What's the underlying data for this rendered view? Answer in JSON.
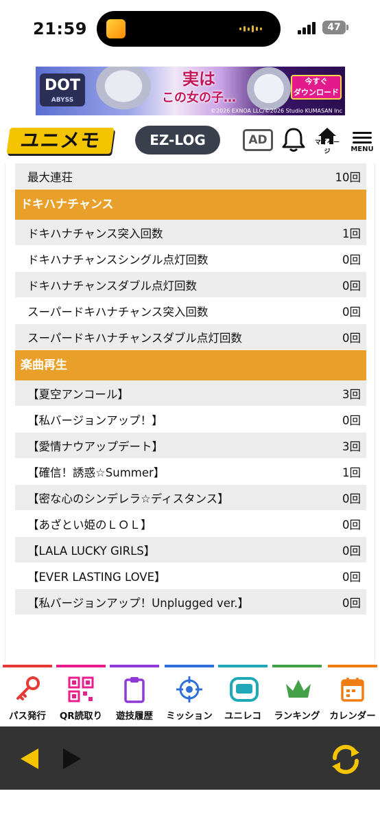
{
  "status_bar": {
    "time": "21:59",
    "battery": "47"
  },
  "banner": {
    "game_logo": "DOT",
    "game_logo_sub": "ABYSS",
    "copy_line1": "実は",
    "copy_line2": "この女の子…",
    "cta_line1": "今すぐ",
    "cta_line2": "ダウンロード",
    "copyright": "©2026 EXNOA LLC/©2026 Studio KUMASAN Inc"
  },
  "header": {
    "logo": "ユニメモ",
    "ezlog_label": "EZ-LOG",
    "ad_label": "AD",
    "mypage_label": "マイページ",
    "menu_label": "MENU"
  },
  "stats": {
    "top_rows": [
      {
        "label": "最大連荘",
        "value": "10回"
      }
    ],
    "sections": [
      {
        "title": "ドキハナチャンス",
        "rows": [
          {
            "label": "ドキハナチャンス突入回数",
            "value": "1回"
          },
          {
            "label": "ドキハナチャンスシングル点灯回数",
            "value": "0回"
          },
          {
            "label": "ドキハナチャンスダブル点灯回数",
            "value": "0回"
          },
          {
            "label": "スーパードキハナチャンス突入回数",
            "value": "0回"
          },
          {
            "label": "スーパードキハナチャンスダブル点灯回数",
            "value": "0回"
          }
        ]
      },
      {
        "title": "楽曲再生",
        "rows": [
          {
            "label": "【夏空アンコール】",
            "value": "3回"
          },
          {
            "label": "【私バージョンアップ！】",
            "value": "0回"
          },
          {
            "label": "【愛情ナウアップデート】",
            "value": "3回"
          },
          {
            "label": "【確信！誘惑☆Summer】",
            "value": "1回"
          },
          {
            "label": "【密な心のシンデレラ☆ディスタンス】",
            "value": "0回"
          },
          {
            "label": "【あざとい姫のＬＯＬ】",
            "value": "0回"
          },
          {
            "label": "【LALA LUCKY GIRLS】",
            "value": "0回"
          },
          {
            "label": "【EVER LASTING LOVE】",
            "value": "0回"
          },
          {
            "label": "【私バージョンアップ！Unplugged ver.】",
            "value": "0回"
          }
        ]
      }
    ]
  },
  "tabbar": {
    "tabs": [
      {
        "label": "パス発行",
        "icon": "key-icon",
        "color": "#e53935"
      },
      {
        "label": "QR読取り",
        "icon": "qr-code-icon",
        "color": "#e91e8c"
      },
      {
        "label": "遊技履歴",
        "icon": "clipboard-icon",
        "color": "#8e3ad6"
      },
      {
        "label": "ミッション",
        "icon": "target-icon",
        "color": "#2f6fd8"
      },
      {
        "label": "ユニレコ",
        "icon": "unireco-icon",
        "color": "#20a8b8"
      },
      {
        "label": "ランキング",
        "icon": "crown-icon",
        "color": "#43a047"
      },
      {
        "label": "カレンダー",
        "icon": "calendar-icon",
        "color": "#ef7d12"
      }
    ]
  },
  "navbar": {
    "back_icon": "back-arrow-icon",
    "forward_icon": "forward-arrow-icon",
    "reload_icon": "reload-icon",
    "accent": "#f5c400"
  }
}
